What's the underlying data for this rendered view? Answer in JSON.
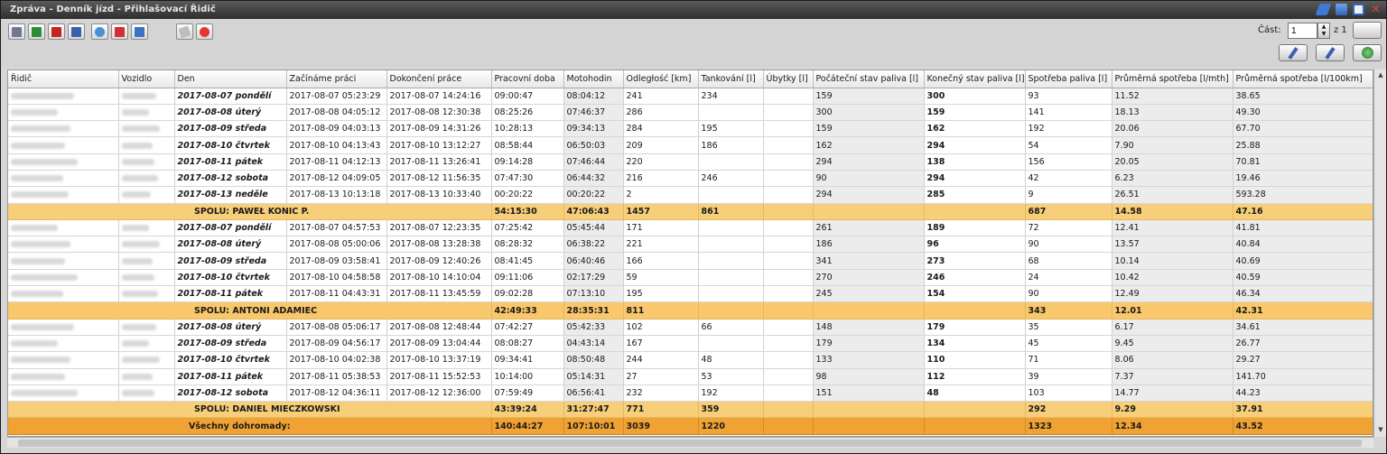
{
  "window": {
    "title": "Zpráva - Denník jízd - Přihlašovací Řidič"
  },
  "paging": {
    "label": "Část:",
    "value": "1",
    "of": "z 1"
  },
  "columns": [
    "Řidič",
    "Vozidlo",
    "Den",
    "Začínáme práci",
    "Dokončení práce",
    "Pracovní doba",
    "Motohodin",
    "Odległość [km]",
    "Tankování [l]",
    "Úbytky [l]",
    "Počáteční stav paliva [l]",
    "Konečný stav paliva [l]",
    "Spotřeba paliva [l]",
    "Průměrná spotřeba [l/mth]",
    "Průměrná spotřeba [l/100km]"
  ],
  "rows": [
    {
      "type": "data",
      "den": "2017-08-07 pondělí",
      "start": "2017-08-07 05:23:29",
      "end": "2017-08-07 14:24:16",
      "work": "09:00:47",
      "moto": "08:04:12",
      "dist": "241",
      "tank": "234",
      "ubytky": "",
      "pstart": "159",
      "pend": "300",
      "spotr": "93",
      "avgh": "11.52",
      "avgkm": "38.65"
    },
    {
      "type": "data",
      "den": "2017-08-08 úterý",
      "start": "2017-08-08 04:05:12",
      "end": "2017-08-08 12:30:38",
      "work": "08:25:26",
      "moto": "07:46:37",
      "dist": "286",
      "tank": "",
      "ubytky": "",
      "pstart": "300",
      "pend": "159",
      "spotr": "141",
      "avgh": "18.13",
      "avgkm": "49.30"
    },
    {
      "type": "data",
      "den": "2017-08-09 středa",
      "start": "2017-08-09 04:03:13",
      "end": "2017-08-09 14:31:26",
      "work": "10:28:13",
      "moto": "09:34:13",
      "dist": "284",
      "tank": "195",
      "ubytky": "",
      "pstart": "159",
      "pend": "162",
      "spotr": "192",
      "avgh": "20.06",
      "avgkm": "67.70"
    },
    {
      "type": "data",
      "den": "2017-08-10 čtvrtek",
      "start": "2017-08-10 04:13:43",
      "end": "2017-08-10 13:12:27",
      "work": "08:58:44",
      "moto": "06:50:03",
      "dist": "209",
      "tank": "186",
      "ubytky": "",
      "pstart": "162",
      "pend": "294",
      "spotr": "54",
      "avgh": "7.90",
      "avgkm": "25.88"
    },
    {
      "type": "data",
      "den": "2017-08-11 pátek",
      "start": "2017-08-11 04:12:13",
      "end": "2017-08-11 13:26:41",
      "work": "09:14:28",
      "moto": "07:46:44",
      "dist": "220",
      "tank": "",
      "ubytky": "",
      "pstart": "294",
      "pend": "138",
      "spotr": "156",
      "avgh": "20.05",
      "avgkm": "70.81"
    },
    {
      "type": "data",
      "den": "2017-08-12 sobota",
      "start": "2017-08-12 04:09:05",
      "end": "2017-08-12 11:56:35",
      "work": "07:47:30",
      "moto": "06:44:32",
      "dist": "216",
      "tank": "246",
      "ubytky": "",
      "pstart": "90",
      "pend": "294",
      "spotr": "42",
      "avgh": "6.23",
      "avgkm": "19.46"
    },
    {
      "type": "data",
      "den": "2017-08-13 neděle",
      "start": "2017-08-13 10:13:18",
      "end": "2017-08-13 10:33:40",
      "work": "00:20:22",
      "moto": "00:20:22",
      "dist": "2",
      "tank": "",
      "ubytky": "",
      "pstart": "294",
      "pend": "285",
      "spotr": "9",
      "avgh": "26.51",
      "avgkm": "593.28"
    },
    {
      "type": "sum",
      "label": "SPOLU: PAWEŁ KONIC P.",
      "work": "54:15:30",
      "moto": "47:06:43",
      "dist": "1457",
      "tank": "861",
      "spotr": "687",
      "avgh": "14.58",
      "avgkm": "47.16"
    },
    {
      "type": "data",
      "den": "2017-08-07 pondělí",
      "start": "2017-08-07 04:57:53",
      "end": "2017-08-07 12:23:35",
      "work": "07:25:42",
      "moto": "05:45:44",
      "dist": "171",
      "tank": "",
      "ubytky": "",
      "pstart": "261",
      "pend": "189",
      "spotr": "72",
      "avgh": "12.41",
      "avgkm": "41.81"
    },
    {
      "type": "data",
      "den": "2017-08-08 úterý",
      "start": "2017-08-08 05:00:06",
      "end": "2017-08-08 13:28:38",
      "work": "08:28:32",
      "moto": "06:38:22",
      "dist": "221",
      "tank": "",
      "ubytky": "",
      "pstart": "186",
      "pend": "96",
      "spotr": "90",
      "avgh": "13.57",
      "avgkm": "40.84"
    },
    {
      "type": "data",
      "den": "2017-08-09 středa",
      "start": "2017-08-09 03:58:41",
      "end": "2017-08-09 12:40:26",
      "work": "08:41:45",
      "moto": "06:40:46",
      "dist": "166",
      "tank": "",
      "ubytky": "",
      "pstart": "341",
      "pend": "273",
      "spotr": "68",
      "avgh": "10.14",
      "avgkm": "40.69"
    },
    {
      "type": "data",
      "den": "2017-08-10 čtvrtek",
      "start": "2017-08-10 04:58:58",
      "end": "2017-08-10 14:10:04",
      "work": "09:11:06",
      "moto": "02:17:29",
      "dist": "59",
      "tank": "",
      "ubytky": "",
      "pstart": "270",
      "pend": "246",
      "spotr": "24",
      "avgh": "10.42",
      "avgkm": "40.59"
    },
    {
      "type": "data",
      "den": "2017-08-11 pátek",
      "start": "2017-08-11 04:43:31",
      "end": "2017-08-11 13:45:59",
      "work": "09:02:28",
      "moto": "07:13:10",
      "dist": "195",
      "tank": "",
      "ubytky": "",
      "pstart": "245",
      "pend": "154",
      "spotr": "90",
      "avgh": "12.49",
      "avgkm": "46.34"
    },
    {
      "type": "sum",
      "alt": true,
      "label": "SPOLU: ANTONI ADAMIEC",
      "work": "42:49:33",
      "moto": "28:35:31",
      "dist": "811",
      "tank": "",
      "spotr": "343",
      "avgh": "12.01",
      "avgkm": "42.31"
    },
    {
      "type": "data",
      "den": "2017-08-08 úterý",
      "start": "2017-08-08 05:06:17",
      "end": "2017-08-08 12:48:44",
      "work": "07:42:27",
      "moto": "05:42:33",
      "dist": "102",
      "tank": "66",
      "ubytky": "",
      "pstart": "148",
      "pend": "179",
      "spotr": "35",
      "avgh": "6.17",
      "avgkm": "34.61"
    },
    {
      "type": "data",
      "den": "2017-08-09 středa",
      "start": "2017-08-09 04:56:17",
      "end": "2017-08-09 13:04:44",
      "work": "08:08:27",
      "moto": "04:43:14",
      "dist": "167",
      "tank": "",
      "ubytky": "",
      "pstart": "179",
      "pend": "134",
      "spotr": "45",
      "avgh": "9.45",
      "avgkm": "26.77"
    },
    {
      "type": "data",
      "den": "2017-08-10 čtvrtek",
      "start": "2017-08-10 04:02:38",
      "end": "2017-08-10 13:37:19",
      "work": "09:34:41",
      "moto": "08:50:48",
      "dist": "244",
      "tank": "48",
      "ubytky": "",
      "pstart": "133",
      "pend": "110",
      "spotr": "71",
      "avgh": "8.06",
      "avgkm": "29.27"
    },
    {
      "type": "data",
      "den": "2017-08-11 pátek",
      "start": "2017-08-11 05:38:53",
      "end": "2017-08-11 15:52:53",
      "work": "10:14:00",
      "moto": "05:14:31",
      "dist": "27",
      "tank": "53",
      "ubytky": "",
      "pstart": "98",
      "pend": "112",
      "spotr": "39",
      "avgh": "7.37",
      "avgkm": "141.70"
    },
    {
      "type": "data",
      "den": "2017-08-12 sobota",
      "start": "2017-08-12 04:36:11",
      "end": "2017-08-12 12:36:00",
      "work": "07:59:49",
      "moto": "06:56:41",
      "dist": "232",
      "tank": "192",
      "ubytky": "",
      "pstart": "151",
      "pend": "48",
      "spotr": "103",
      "avgh": "14.77",
      "avgkm": "44.23"
    },
    {
      "type": "sum",
      "label": "SPOLU: DANIEL MIECZKOWSKI",
      "work": "43:39:24",
      "moto": "31:27:47",
      "dist": "771",
      "tank": "359",
      "spotr": "292",
      "avgh": "9.29",
      "avgkm": "37.91"
    },
    {
      "type": "total",
      "label": "Všechny dohromady:",
      "work": "140:44:27",
      "moto": "107:10:01",
      "dist": "3039",
      "tank": "1220",
      "spotr": "1323",
      "avgh": "12.34",
      "avgkm": "43.52"
    }
  ]
}
